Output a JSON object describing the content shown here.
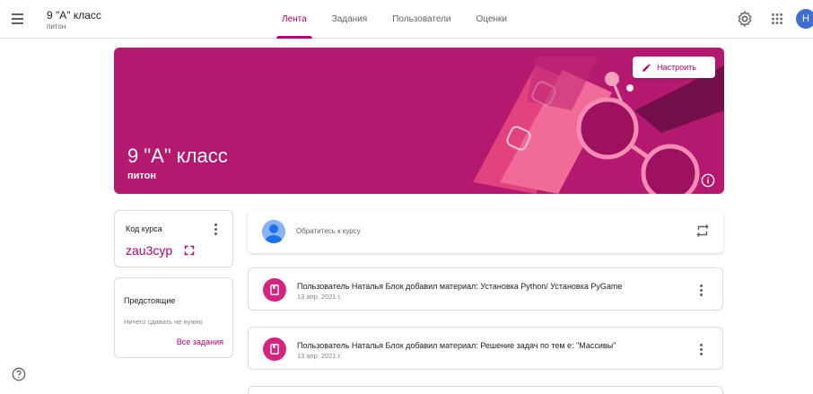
{
  "header": {
    "class_title": "9 \"А\" класс",
    "class_subtitle": "питон",
    "tabs": [
      {
        "label": "Лента",
        "active": true
      },
      {
        "label": "Задания",
        "active": false
      },
      {
        "label": "Пользователи",
        "active": false
      },
      {
        "label": "Оценки",
        "active": false
      }
    ],
    "avatar_letter": "Н"
  },
  "banner": {
    "title": "9 \"А\" класс",
    "subtitle": "питон",
    "customize_label": "Настроить"
  },
  "course_code": {
    "label": "Код курса",
    "value": "zau3cyp"
  },
  "upcoming": {
    "title": "Предстоящие",
    "empty_text": "Ничего сдавать не нужно",
    "link": "Все задания"
  },
  "share": {
    "placeholder": "Обратитесь к курсу"
  },
  "posts": [
    {
      "title": "Пользователь Наталья Блок добавил материал: Установка Python/ Установка PyGame",
      "date": "13 апр. 2021 г."
    },
    {
      "title": "Пользователь Наталья Блок добавил материал: Решение задач по тем е: \"Массивы\"",
      "date": "13 апр. 2021 г."
    }
  ],
  "colors": {
    "accent": "#b5006f",
    "banner": "#b5196f",
    "avatar": "#3f6fd1"
  }
}
